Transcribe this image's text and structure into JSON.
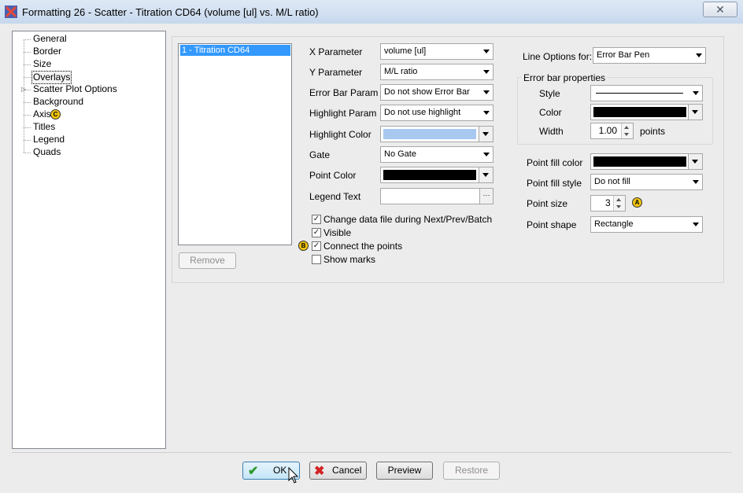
{
  "window": {
    "title": "Formatting 26 - Scatter - Titration CD64 (volume [ul] vs. M/L ratio)",
    "close_glyph": "✕"
  },
  "tree": {
    "items": [
      {
        "label": "General"
      },
      {
        "label": "Border"
      },
      {
        "label": "Size"
      },
      {
        "label": "Overlays",
        "selected": true
      },
      {
        "label": "Scatter Plot Options",
        "expandable": true
      },
      {
        "label": "Background"
      },
      {
        "label": "Axis",
        "marker": "C"
      },
      {
        "label": "Titles"
      },
      {
        "label": "Legend"
      },
      {
        "label": "Quads"
      }
    ]
  },
  "overlays": {
    "list": [
      "1 - Titration CD64"
    ],
    "remove_label": "Remove"
  },
  "params": {
    "x_label": "X Parameter",
    "x_value": "volume [ul]",
    "y_label": "Y Parameter",
    "y_value": "M/L ratio",
    "errorbar_label": "Error Bar Param",
    "errorbar_value": "Do not show Error Bar",
    "highlight_label": "Highlight Param",
    "highlight_value": "Do not use highlight",
    "highlight_color_label": "Highlight Color",
    "highlight_color": "#a8c8f0",
    "gate_label": "Gate",
    "gate_value": "No Gate",
    "point_color_label": "Point Color",
    "point_color": "#000000",
    "legend_text_label": "Legend Text",
    "legend_text_value": "",
    "legend_browse": "···"
  },
  "checkboxes": [
    {
      "label": "Change data file during Next/Prev/Batch",
      "checked": true
    },
    {
      "label": "Visible",
      "checked": true
    },
    {
      "label": "Connect the points",
      "checked": true,
      "marker": "B"
    },
    {
      "label": "Show marks",
      "checked": false
    }
  ],
  "line_options": {
    "label": "Line Options for:",
    "value": "Error Bar Pen",
    "group_title": "Error bar properties",
    "style_label": "Style",
    "color_label": "Color",
    "color": "#000000",
    "width_label": "Width",
    "width_value": "1.00",
    "width_unit": "points"
  },
  "point": {
    "fill_color_label": "Point fill color",
    "fill_color": "#000000",
    "fill_style_label": "Point fill style",
    "fill_style_value": "Do not fill",
    "size_label": "Point size",
    "size_value": "3",
    "size_marker": "A",
    "shape_label": "Point shape",
    "shape_value": "Rectangle"
  },
  "buttons": {
    "ok": "OK",
    "cancel": "Cancel",
    "preview": "Preview",
    "restore": "Restore"
  },
  "colors": {
    "marker": "#f1c40f",
    "selection": "#3399ff"
  }
}
